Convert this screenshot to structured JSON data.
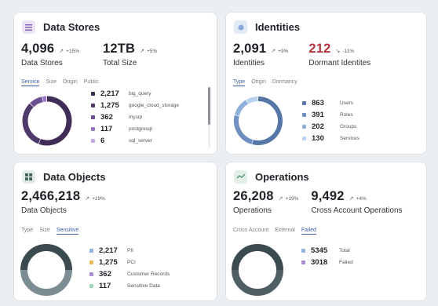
{
  "data_stores": {
    "title": "Data Stores",
    "icon": "list-icon",
    "accent": "#7b5ea7",
    "kpis": [
      {
        "value": "4,096",
        "trend": "+15%",
        "label": "Data Stores"
      },
      {
        "value": "12TB",
        "trend": "+5%",
        "label": "Total Size"
      }
    ],
    "tabs": [
      "Service",
      "Size",
      "Origin",
      "Public"
    ],
    "active_tab": "Service",
    "items": [
      {
        "value": "2,217",
        "name": "big_query",
        "color": "#3f2c57",
        "count": 2217
      },
      {
        "value": "1,275",
        "name": "google_cloud_storage",
        "color": "#4d3a6b",
        "count": 1275
      },
      {
        "value": "362",
        "name": "mysql",
        "color": "#6b4f93",
        "count": 362
      },
      {
        "value": "117",
        "name": "postgresql",
        "color": "#9a74c9",
        "count": 117
      },
      {
        "value": "6",
        "name": "sql_server",
        "color": "#c7a8e6",
        "count": 6
      }
    ]
  },
  "identities": {
    "title": "Identities",
    "icon": "circle-icon",
    "accent": "#8aa7d6",
    "kpis": [
      {
        "value": "2,091",
        "trend": "+9%",
        "label": "Identities",
        "color": "#1f2328"
      },
      {
        "value": "212",
        "trend": "-11%",
        "label": "Dormant Identites",
        "color": "#b3343c"
      }
    ],
    "tabs": [
      "Type",
      "Origin",
      "Dormancy"
    ],
    "active_tab": "Type",
    "items": [
      {
        "value": "863",
        "name": "Users",
        "color": "#5577a8",
        "count": 863
      },
      {
        "value": "391",
        "name": "Roles",
        "color": "#6e8fc0",
        "count": 391
      },
      {
        "value": "202",
        "name": "Groups",
        "color": "#8fb0d9",
        "count": 202
      },
      {
        "value": "130",
        "name": "Services",
        "color": "#b8d2ef",
        "count": 130
      }
    ]
  },
  "data_objects": {
    "title": "Data Objects",
    "icon": "grid-icon",
    "accent": "#3e5f55",
    "kpis": [
      {
        "value": "2,466,218",
        "trend": "+19%",
        "label": "Data Objects"
      }
    ],
    "tabs": [
      "Type",
      "Size",
      "Sensitive"
    ],
    "active_tab": "Sensitive",
    "items": [
      {
        "value": "2,217",
        "name": "PII",
        "color": "#8fb0d9",
        "count": 2217
      },
      {
        "value": "1,275",
        "name": "PCI",
        "color": "#e9b95a",
        "count": 1275
      },
      {
        "value": "362",
        "name": "Customer Records",
        "color": "#a88ad0",
        "count": 362
      },
      {
        "value": "117",
        "name": "Sensitive Data",
        "color": "#9fd8b8",
        "count": 117
      }
    ],
    "ring_colors": [
      "#3b4a4e",
      "#7b8d92"
    ]
  },
  "operations": {
    "title": "Operations",
    "icon": "trend-icon",
    "accent": "#4e8f6a",
    "kpis": [
      {
        "value": "26,208",
        "trend": "+19%",
        "label": "Operations"
      },
      {
        "value": "9,492",
        "trend": "+4%",
        "label": "Cross Account Operations"
      }
    ],
    "tabs": [
      "Cross Account",
      "External",
      "Failed"
    ],
    "active_tab": "Failed",
    "items": [
      {
        "value": "5345",
        "name": "Total",
        "color": "#8fb0d9",
        "count": 5345
      },
      {
        "value": "3018",
        "name": "Failed",
        "color": "#a88ad0",
        "count": 3018
      }
    ],
    "ring_colors": [
      "#3b4a4e",
      "#4f5f63"
    ]
  }
}
